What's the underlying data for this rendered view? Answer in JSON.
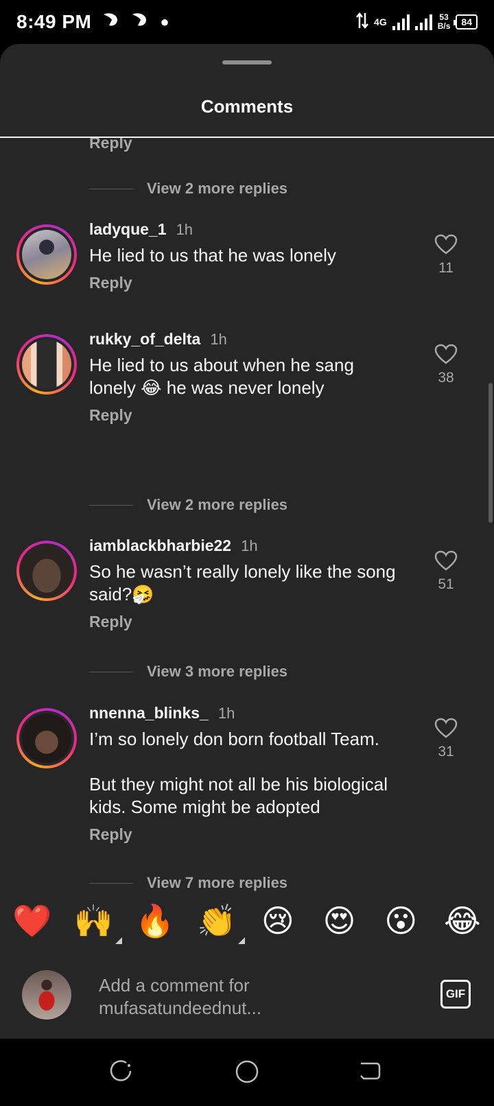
{
  "status_bar": {
    "time": "8:49 PM",
    "network_type": "4G",
    "data_rate_value": "53",
    "data_rate_unit": "B/s",
    "battery": "84"
  },
  "sheet": {
    "title": "Comments"
  },
  "thread": {
    "top_reply_label": "Reply",
    "top_view_more": "View 2 more replies"
  },
  "comments": [
    {
      "username": "ladyque_1",
      "time": "1h",
      "lines": [
        "He lied to us that he was lonely"
      ],
      "reply_label": "Reply",
      "likes": "11"
    },
    {
      "username": "rukky_of_delta",
      "time": "1h",
      "lines": [
        "He lied to us about when he sang",
        "lonely 😂 he was never lonely"
      ],
      "reply_label": "Reply",
      "likes": "38",
      "view_more": "View 2 more replies"
    },
    {
      "username": "iamblackbharbie22",
      "time": "1h",
      "lines": [
        "So he wasn’t really lonely like the song",
        "said?🤧"
      ],
      "reply_label": "Reply",
      "likes": "51",
      "view_more": "View 3 more replies"
    },
    {
      "username": "nnenna_blinks_",
      "time": "1h",
      "lines": [
        "I’m so lonely don born football Team.",
        "",
        "But they might not all be his biological",
        "kids. Some might be adopted"
      ],
      "reply_label": "Reply",
      "likes": "31",
      "view_more": "View 7 more replies"
    }
  ],
  "reactions": [
    "❤️",
    "🙌",
    "🔥",
    "👏",
    "😢",
    "😍",
    "😮",
    "😂"
  ],
  "composer": {
    "placeholder_line1": "Add a comment for",
    "placeholder_line2": "mufasatundeednut...",
    "gif_label": "GIF"
  },
  "colors": {
    "sheet_background": "#262626",
    "secondary_text": "#a8a8a8",
    "ring_gradient": [
      "#f9a825",
      "#ee2a7b",
      "#b12cc6"
    ]
  }
}
